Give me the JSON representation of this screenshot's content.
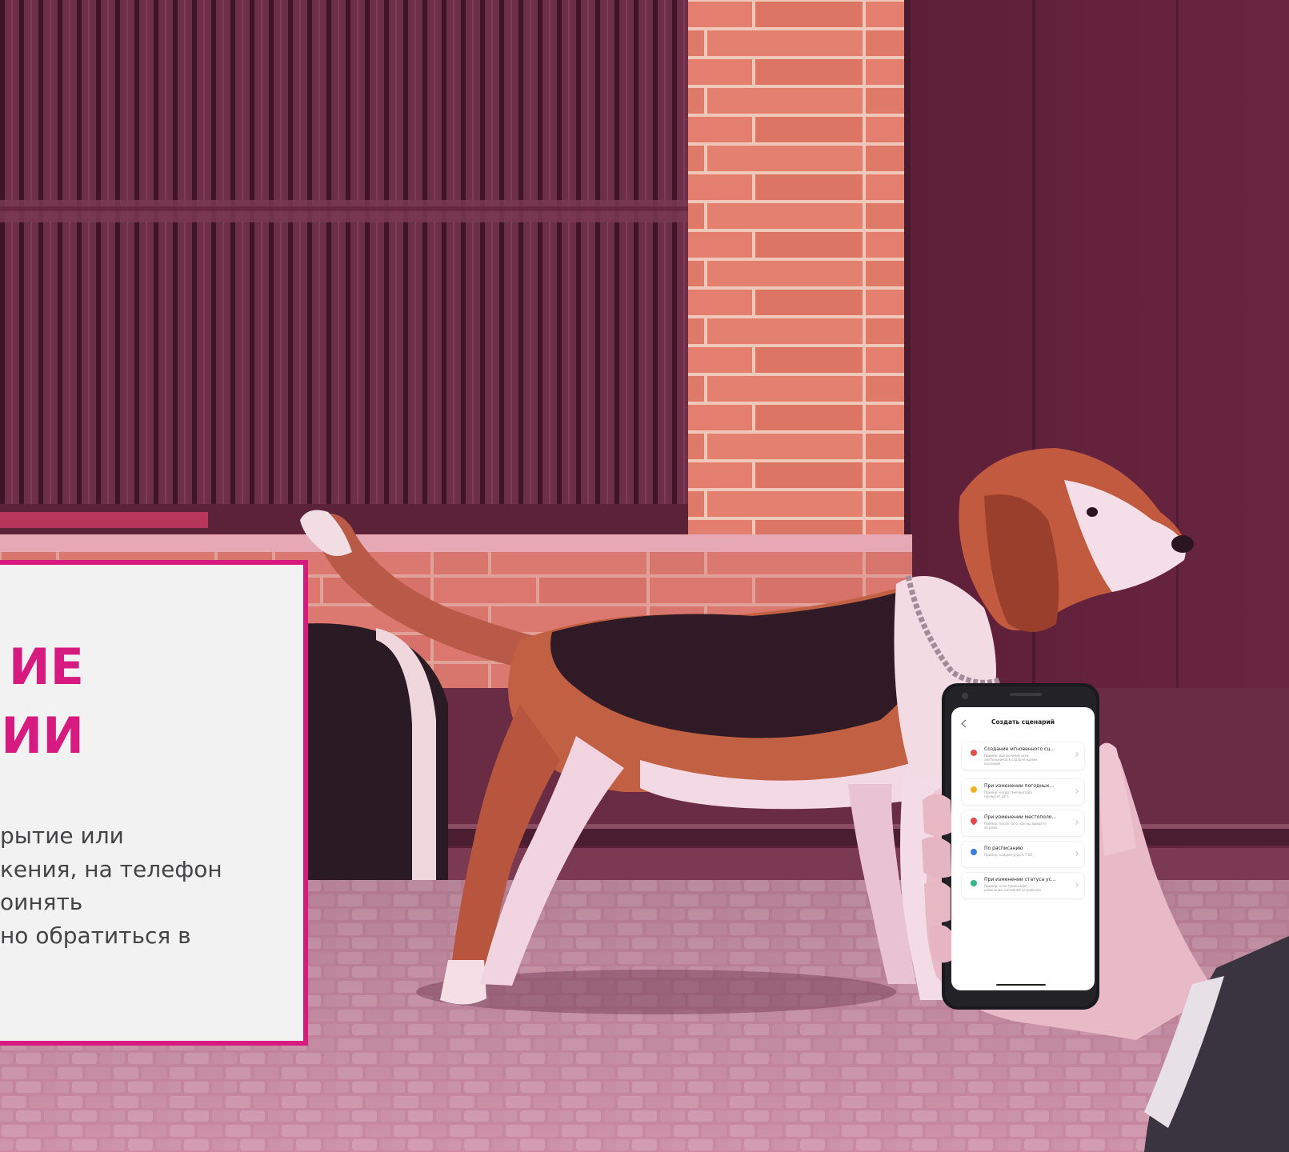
{
  "info_card": {
    "title": "ИЕ\nИИ",
    "body": "рытие или\nкения, на телефон\nоинять\nно обратиться в"
  },
  "phone": {
    "screen_title": "Создать сценарий",
    "scenarios": [
      {
        "title": "Создание мгновенного сц...",
        "description": "Пример: выключение всех\nсветильников в спальне одним\nкасанием",
        "icon": "tap-icon",
        "icon_color": "#e2504b"
      },
      {
        "title": "При изменении погодных...",
        "description": "Пример: когда температура\nпревысит 28°C",
        "icon": "sun-icon",
        "icon_color": "#f2b320"
      },
      {
        "title": "При изменении местополо...",
        "description": "Пример: после того, как вы выйдете\nиз дома",
        "icon": "location-pin-icon",
        "icon_color": "#e24848"
      },
      {
        "title": "По расписанию",
        "description": "Пример: каждое утро в 7:00",
        "icon": "clock-icon",
        "icon_color": "#3d7be0"
      },
      {
        "title": "При изменении статуса ус...",
        "description": "Пример: если происходит\nизменение состояния устройства",
        "icon": "device-status-icon",
        "icon_color": "#2fb784"
      }
    ]
  },
  "colors": {
    "accent": "#d61a7f",
    "overlay": "#8a2a55",
    "card_background": "#f2f2f2"
  }
}
